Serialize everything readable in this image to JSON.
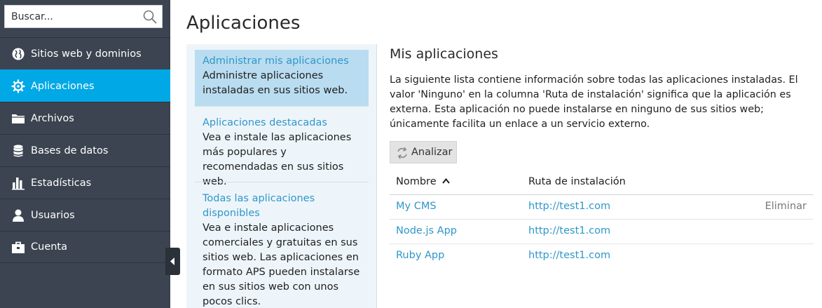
{
  "search": {
    "placeholder": "Buscar..."
  },
  "sidebar": {
    "items": [
      {
        "label": "Sitios web y dominios",
        "icon": "globe-icon"
      },
      {
        "label": "Aplicaciones",
        "icon": "gear-icon",
        "active": true
      },
      {
        "label": "Archivos",
        "icon": "folder-icon"
      },
      {
        "label": "Bases de datos",
        "icon": "database-icon"
      },
      {
        "label": "Estadísticas",
        "icon": "bar-chart-icon"
      },
      {
        "label": "Usuarios",
        "icon": "user-icon"
      },
      {
        "label": "Cuenta",
        "icon": "briefcase-icon"
      }
    ]
  },
  "main": {
    "title": "Aplicaciones",
    "left_panel": {
      "items": [
        {
          "link": "Administrar mis aplicaciones",
          "desc": "Administre aplicaciones instaladas en sus sitios web."
        },
        {
          "link": "Aplicaciones destacadas",
          "desc": "Vea e instale las aplicaciones más populares y recomendadas en sus sitios web."
        },
        {
          "link": "Todas las aplicaciones disponibles",
          "desc": "Vea e instale aplicaciones comerciales y gratuitas en sus sitios web. Las aplicaciones en formato APS pueden instalarse en sus sitios web con unos pocos clics."
        }
      ]
    },
    "section_title": "Mis aplicaciones",
    "description": "La siguiente lista contiene información sobre todas las aplicaciones instaladas. El valor 'Ninguno' en la columna 'Ruta de instalación' significa que la aplicación es externa. Esta aplicación no puede instalarse en ninguno de sus sitios web; únicamente facilita un enlace a un servicio externo.",
    "analyze_label": "Analizar",
    "table": {
      "headers": {
        "name": "Nombre",
        "path": "Ruta de instalación"
      },
      "rows": [
        {
          "name": "My CMS",
          "path": "http://test1.com",
          "action": "Eliminar"
        },
        {
          "name": "Node.js App",
          "path": "http://test1.com",
          "action": ""
        },
        {
          "name": "Ruby App",
          "path": "http://test1.com",
          "action": ""
        }
      ]
    }
  },
  "colors": {
    "sidebar_bg": "#3b4450",
    "active": "#00a8e6",
    "link": "#2f97c9",
    "panel_bg": "#eef5fa",
    "panel_active": "#b9dcf0"
  }
}
